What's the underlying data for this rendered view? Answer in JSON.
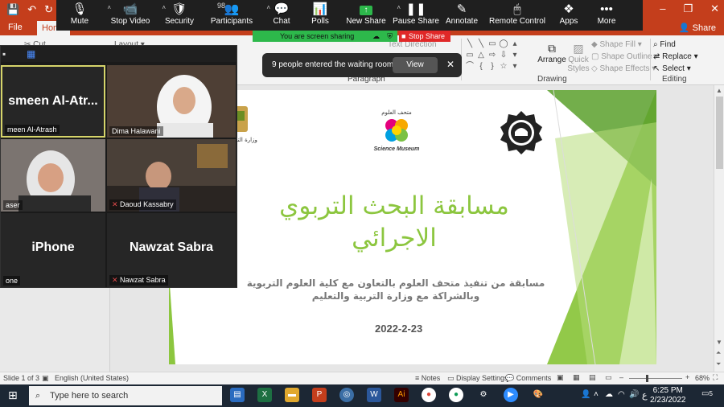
{
  "ppt": {
    "tabs": {
      "file": "File",
      "home": "Home",
      "share": "Share"
    },
    "ribbon": {
      "groups": {
        "paragraph": "Paragraph",
        "drawing": "Drawing",
        "editing": "Editing"
      },
      "text_direction": "Text Direction",
      "layout": "Layout",
      "cut": "Cut",
      "arrange": "Arrange",
      "quick_styles": "Quick Styles",
      "shape_fill": "Shape Fill",
      "shape_outline": "Shape Outline",
      "shape_effects": "Shape Effects",
      "find": "Find",
      "replace": "Replace",
      "select": "Select"
    },
    "status": {
      "slide": "Slide 1 of 3",
      "language": "English (United States)",
      "notes": "Notes",
      "display": "Display Settings",
      "comments": "Comments",
      "zoom": "68%"
    }
  },
  "zoom": {
    "toolbar": [
      {
        "label": "Mute",
        "icon": "🎙"
      },
      {
        "label": "Stop Video",
        "icon": "📹"
      },
      {
        "label": "Security",
        "icon": "🛡"
      },
      {
        "label": "Participants",
        "icon": "👥",
        "badge": "98"
      },
      {
        "label": "Chat",
        "icon": "💬"
      },
      {
        "label": "Polls",
        "icon": "📊"
      },
      {
        "label": "New Share",
        "icon": "↑"
      },
      {
        "label": "Pause Share",
        "icon": "❚❚"
      },
      {
        "label": "Annotate",
        "icon": "✎"
      },
      {
        "label": "Remote Control",
        "icon": "🖱"
      },
      {
        "label": "Apps",
        "icon": "❖"
      },
      {
        "label": "More",
        "icon": "•••"
      }
    ],
    "sharing_status": "You are screen sharing",
    "stop_share": "Stop Share",
    "toast": {
      "message": "9 people entered the waiting room",
      "view": "View"
    },
    "participants": [
      {
        "name": "Yasmeen Al-Atrash",
        "big": "smeen  Al-Atr...",
        "label": "meen Al-Atrash"
      },
      {
        "name": "Dima Halawani",
        "label": "Dima Halawani"
      },
      {
        "label": "aser"
      },
      {
        "label": "Daoud Kassabry"
      },
      {
        "big": "iPhone",
        "label": "one"
      },
      {
        "big": "Nawzat Sabra",
        "label": "Nawzat Sabra"
      }
    ]
  },
  "slide": {
    "title_line1": "مسابقة البحث التربوي",
    "title_line2": "الاجرائي",
    "subtitle_line1": "مسابقة من تنفيذ متحف العلوم بالتعاون مع كلية العلوم التربوية",
    "subtitle_line2": "وبالشراكة مع وزارة التربية والتعليم",
    "date": "2022-2-23",
    "logo_science_ar": "متحف العلوم",
    "logo_science_en": "Science Museum",
    "logo_ministry": "وزارة التربية"
  },
  "taskbar": {
    "search_placeholder": "Type here to search",
    "time": "6:25 PM",
    "date": "2/23/2022",
    "lang": "ع",
    "notifications": "5"
  },
  "colors": {
    "ppt_red": "#c43e1c",
    "zoom_green": "#2db84b",
    "zoom_red": "#e02828",
    "slide_green": "#8cc63f"
  }
}
